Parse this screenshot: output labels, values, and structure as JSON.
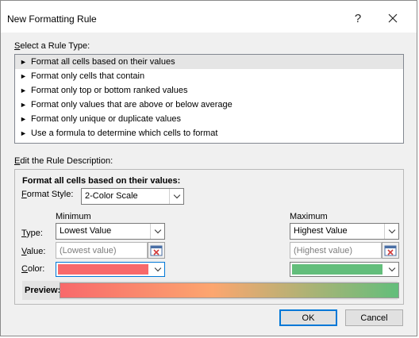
{
  "dialog": {
    "title": "New Formatting Rule",
    "help_label": "?",
    "close_label": "✕"
  },
  "rule_type": {
    "label_prefix": "S",
    "label_rest": "elect a Rule Type:",
    "selected_index": 0,
    "items": [
      {
        "label": "Format all cells based on their values"
      },
      {
        "label": "Format only cells that contain"
      },
      {
        "label": "Format only top or bottom ranked values"
      },
      {
        "label": "Format only values that are above or below average"
      },
      {
        "label": "Format only unique or duplicate values"
      },
      {
        "label": "Use a formula to determine which cells to format"
      }
    ],
    "item_icon": "►"
  },
  "description": {
    "label_prefix": "E",
    "label_rest": "dit the Rule Description:",
    "heading": "Format all cells based on their values:",
    "format_style_prefix": "F",
    "format_style_rest": "ormat Style:",
    "format_style_value": "2-Color Scale",
    "minimum_label": "Minimum",
    "maximum_label": "Maximum",
    "type_prefix": "T",
    "type_rest": "ype:",
    "value_prefix": "V",
    "value_rest": "alue:",
    "color_prefix": "C",
    "color_rest": "olor:",
    "min_type": "Lowest Value",
    "max_type": "Highest Value",
    "min_value_placeholder": "(Lowest value)",
    "max_value_placeholder": "(Highest value)",
    "min_color": "#f8696b",
    "max_color": "#63be7b",
    "preview_label": "Preview:"
  },
  "buttons": {
    "ok": "OK",
    "cancel": "Cancel"
  },
  "colors": {
    "accent": "#0078d7",
    "gradient_start": "#f8696b",
    "gradient_mid": "#fca66f",
    "gradient_end": "#63be7b"
  }
}
